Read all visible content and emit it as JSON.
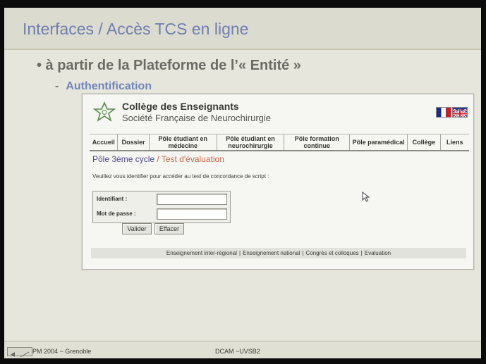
{
  "slide": {
    "title": "Interfaces / Accès TCS en ligne",
    "bullet1": "• à partir de la Plateforme de l’« Entité »",
    "bullet2_dash": "-",
    "bullet2": "Authentification"
  },
  "site": {
    "org_name": "Collège des Enseignants",
    "org_sub": "Société Française de Neurochirurgie",
    "nav": [
      "Accueil",
      "Dossier",
      "Pôle étudiant en médecine",
      "Pôle étudiant en neurochirurgie",
      "Pôle formation continue",
      "Pôle paramédical",
      "Collège",
      "Liens"
    ],
    "breadcrumb": {
      "root": "Pôle 3ème cycle",
      "separator": "/",
      "current": "Test d'évaluation"
    },
    "instruction": "Veuillez vous identifier pour accéder au test de concordance de script :",
    "login": {
      "identifier_label": "Identifiant :",
      "identifier_value": "",
      "password_label": "Mot de passe :",
      "password_value": "",
      "validate_label": "Valider",
      "clear_label": "Effacer"
    },
    "footer_links": [
      "Enseignement inter-régional",
      "Enseignement national",
      "Congrès et colloques",
      "Evaluation"
    ],
    "footer_separator": "|"
  },
  "slide_footer": {
    "left": "PM 2004 ~ Grenoble",
    "center": "DCAM ~UVSB2"
  },
  "colors": {
    "slide_title": "#6f7fb0",
    "subtitle_accent": "#6f85bb",
    "breadcrumb_current": "#c86a4c"
  },
  "icons": [
    "star-logo-icon",
    "french-flag-icon",
    "uk-flag-icon",
    "mouse-cursor-icon",
    "slide-nav-icon"
  ]
}
